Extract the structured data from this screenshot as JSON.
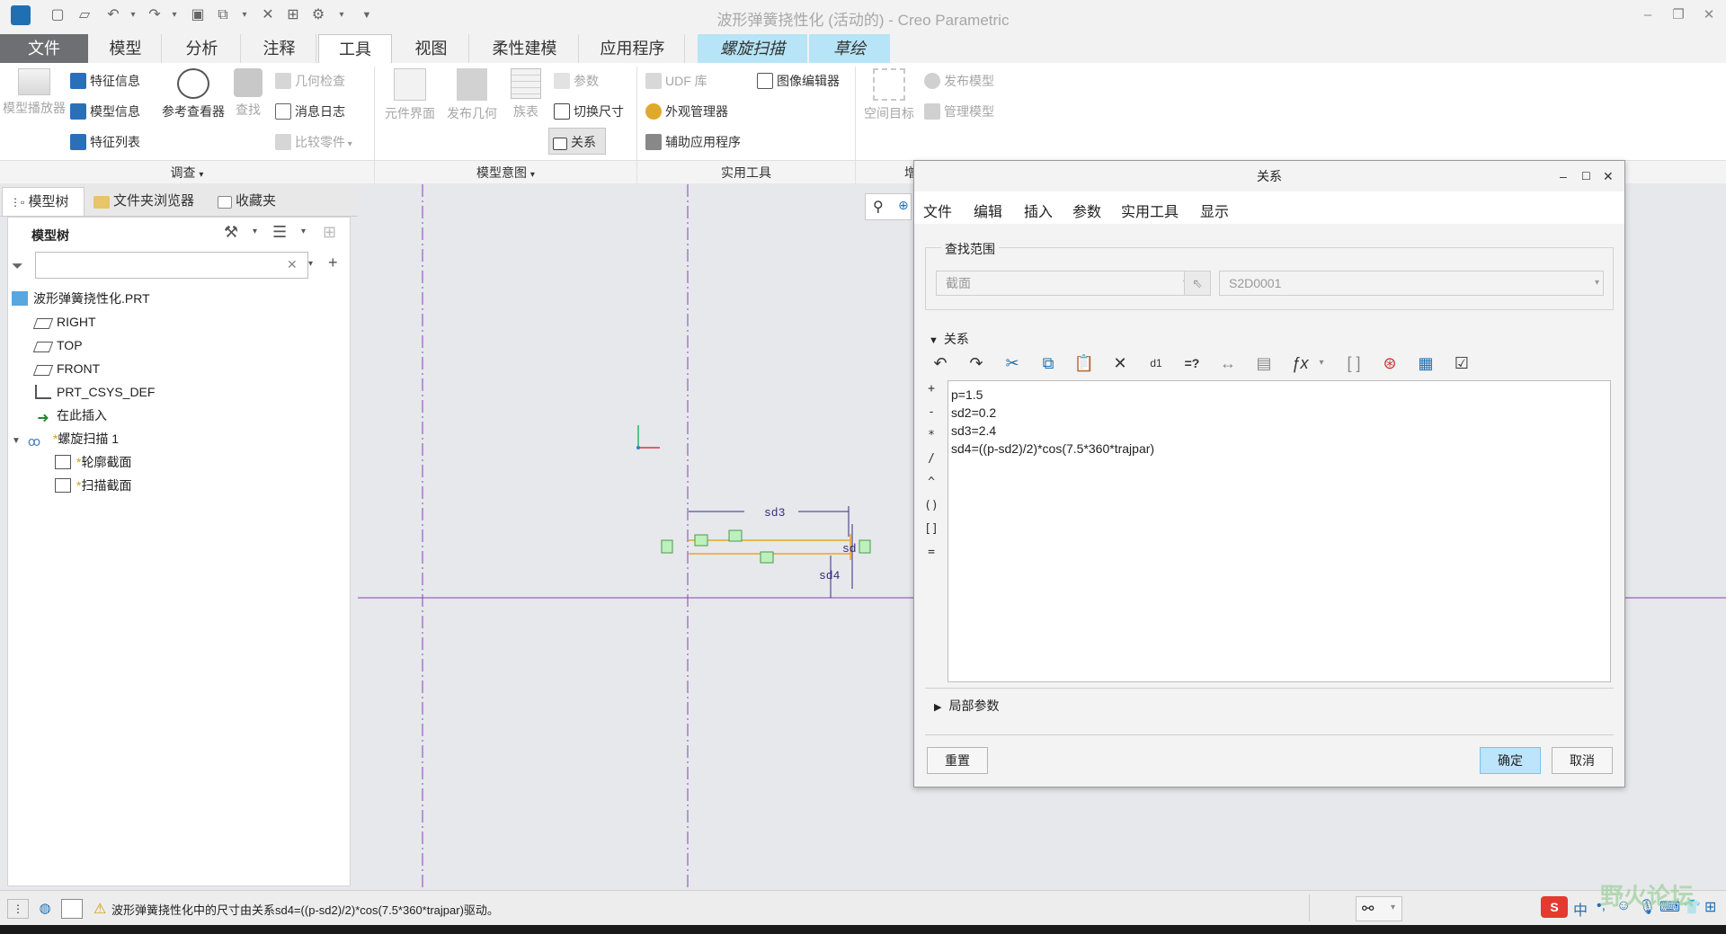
{
  "window": {
    "title": "波形弹簧挠性化 (活动的) - Creo Parametric"
  },
  "ribbon_tabs": [
    {
      "label": "文件"
    },
    {
      "label": "模型"
    },
    {
      "label": "分析"
    },
    {
      "label": "注释"
    },
    {
      "label": "工具"
    },
    {
      "label": "视图"
    },
    {
      "label": "柔性建模"
    },
    {
      "label": "应用程序"
    },
    {
      "label": "螺旋扫描"
    },
    {
      "label": "草绘"
    }
  ],
  "ribbon": {
    "investigate": {
      "model_player": "模型播放器",
      "feature_info": "特征信息",
      "model_info": "模型信息",
      "feature_list": "特征列表",
      "reference_viewer": "参考查看器",
      "find": "查找",
      "geometry_check": "几何检查",
      "message_log": "消息日志",
      "compare_part": "比较零件",
      "group_label": "调查"
    },
    "model_intent": {
      "component_interface": "元件界面",
      "publish_geometry": "发布几何",
      "family_table": "族表",
      "parameters": "参数",
      "switch_dimensions": "切换尺寸",
      "relations": "关系",
      "group_label": "模型意图"
    },
    "utilities": {
      "udf_library": "UDF 库",
      "image_editor": "图像编辑器",
      "appearance_manager": "外观管理器",
      "auxiliary_apps": "辅助应用程序",
      "group_label": "实用工具"
    },
    "publish": {
      "spatial_target": "空间目标",
      "publish_model": "发布模型",
      "manage_model": "管理模型",
      "group_label_fragment": "增"
    }
  },
  "left_panel": {
    "tabs": [
      {
        "label": "模型树"
      },
      {
        "label": "文件夹浏览器"
      },
      {
        "label": "收藏夹"
      }
    ],
    "header": "模型树",
    "search_placeholder": "",
    "tree": [
      {
        "label": "波形弹簧挠性化.PRT"
      },
      {
        "label": "RIGHT"
      },
      {
        "label": "TOP"
      },
      {
        "label": "FRONT"
      },
      {
        "label": "PRT_CSYS_DEF"
      },
      {
        "label": "在此插入"
      },
      {
        "label": "螺旋扫描 1"
      },
      {
        "label": "轮廓截面"
      },
      {
        "label": "扫描截面"
      }
    ]
  },
  "sketch": {
    "dim_sd3": "sd3",
    "dim_sd4": "sd4",
    "dim_sd_partial": "sd"
  },
  "dialog": {
    "title": "关系",
    "menu": [
      "文件",
      "编辑",
      "插入",
      "参数",
      "实用工具",
      "显示"
    ],
    "lookup_scope_label": "查找范围",
    "scope_type_value": "截面",
    "scope_name_value": "S2D0001",
    "relations_section": "关系",
    "operators": [
      "+",
      "-",
      "*",
      "/",
      "^",
      "()",
      "[]",
      "="
    ],
    "relations_text": [
      "p=1.5",
      "sd2=0.2",
      "sd3=2.4",
      "sd4=((p-sd2)/2)*cos(7.5*360*trajpar)"
    ],
    "local_params_section": "局部参数",
    "reset_button": "重置",
    "ok_button": "确定",
    "cancel_button": "取消"
  },
  "status": {
    "message": "波形弹簧挠性化中的尺寸由关系sd4=((p-sd2)/2)*cos(7.5*360*trajpar)驱动。"
  },
  "watermark": "野火论坛",
  "colors": {
    "file_tab": "#6d6f72",
    "context_tab": "#b7e4f7",
    "primary_button": "#bce4fb",
    "sketch_line": "#8b3fb5",
    "section_line": "#e8a526",
    "dimension_color": "#3a2a7a"
  }
}
